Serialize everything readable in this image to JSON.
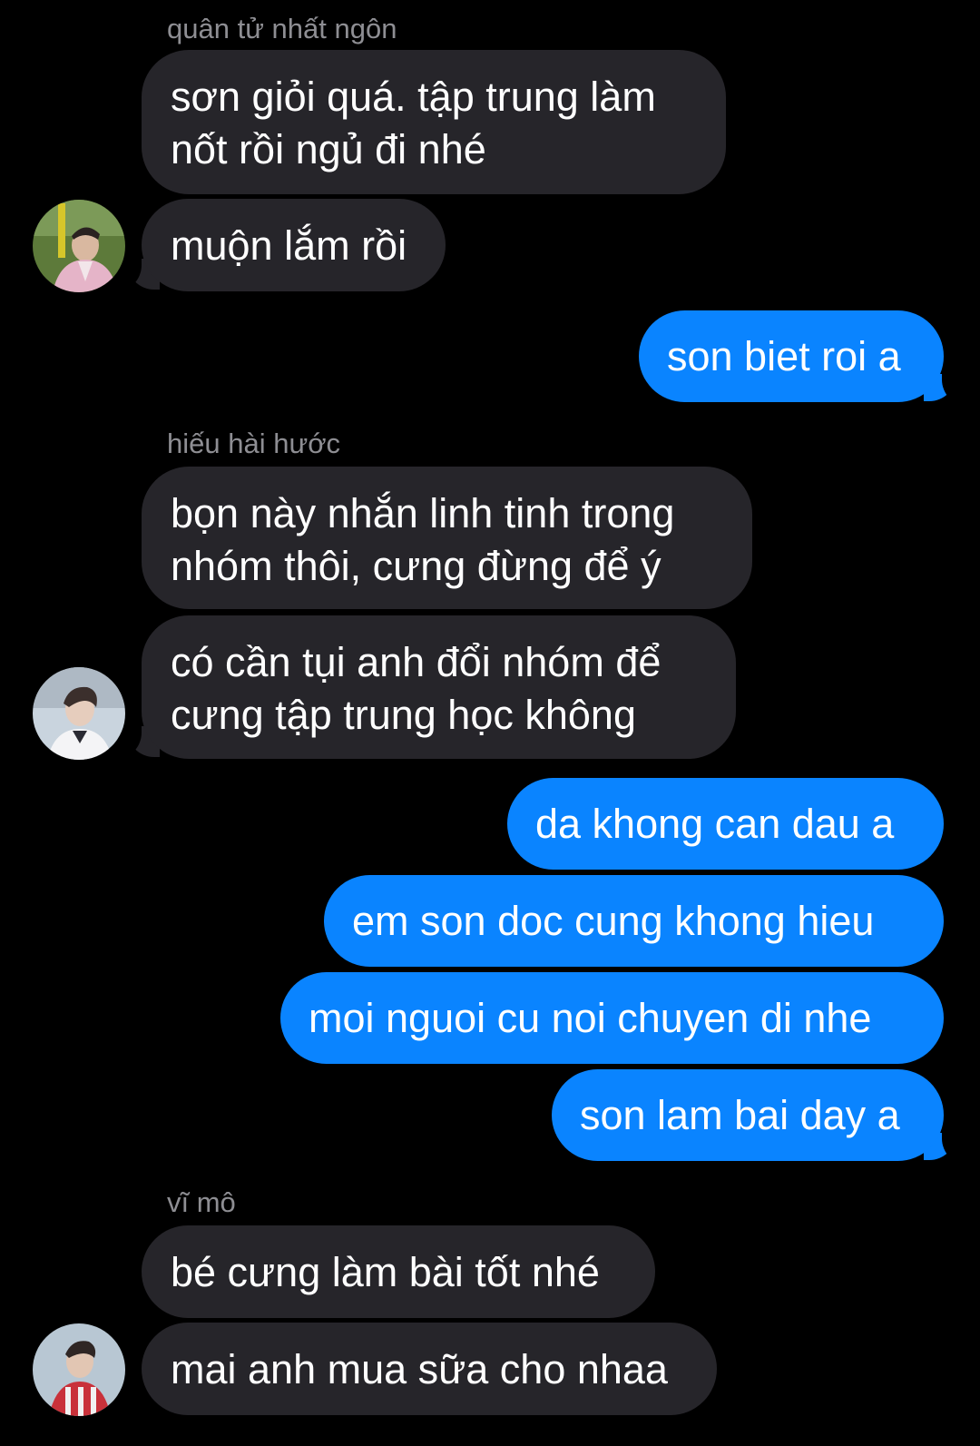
{
  "messages": {
    "group1": {
      "sender": "quân tử nhất ngôn",
      "line1": "sơn giỏi quá. tập trung làm",
      "line2": "nốt rồi ngủ đi nhé",
      "msg2": "muộn lắm rồi"
    },
    "out1": "son biet roi a",
    "group2": {
      "sender": "hiếu hài hước",
      "m1_line1": "bọn này nhắn linh tinh trong",
      "m1_line2": "nhóm thôi, cưng đừng để ý",
      "m2_line1": "có cần tụi anh đổi nhóm để",
      "m2_line2": "cưng tập trung học không"
    },
    "out2": [
      "da khong can dau a",
      "em son doc cung khong hieu",
      "moi nguoi cu noi chuyen di nhe",
      "son lam bai day a"
    ],
    "group3": {
      "sender": "vĩ mô",
      "msg1": "bé cưng làm bài tốt nhé",
      "msg2": "mai anh mua sữa cho nhaa"
    }
  },
  "colors": {
    "background": "#000000",
    "incoming_bubble": "#26252a",
    "outgoing_bubble": "#0a84ff",
    "sender_name": "#8e8e93"
  }
}
